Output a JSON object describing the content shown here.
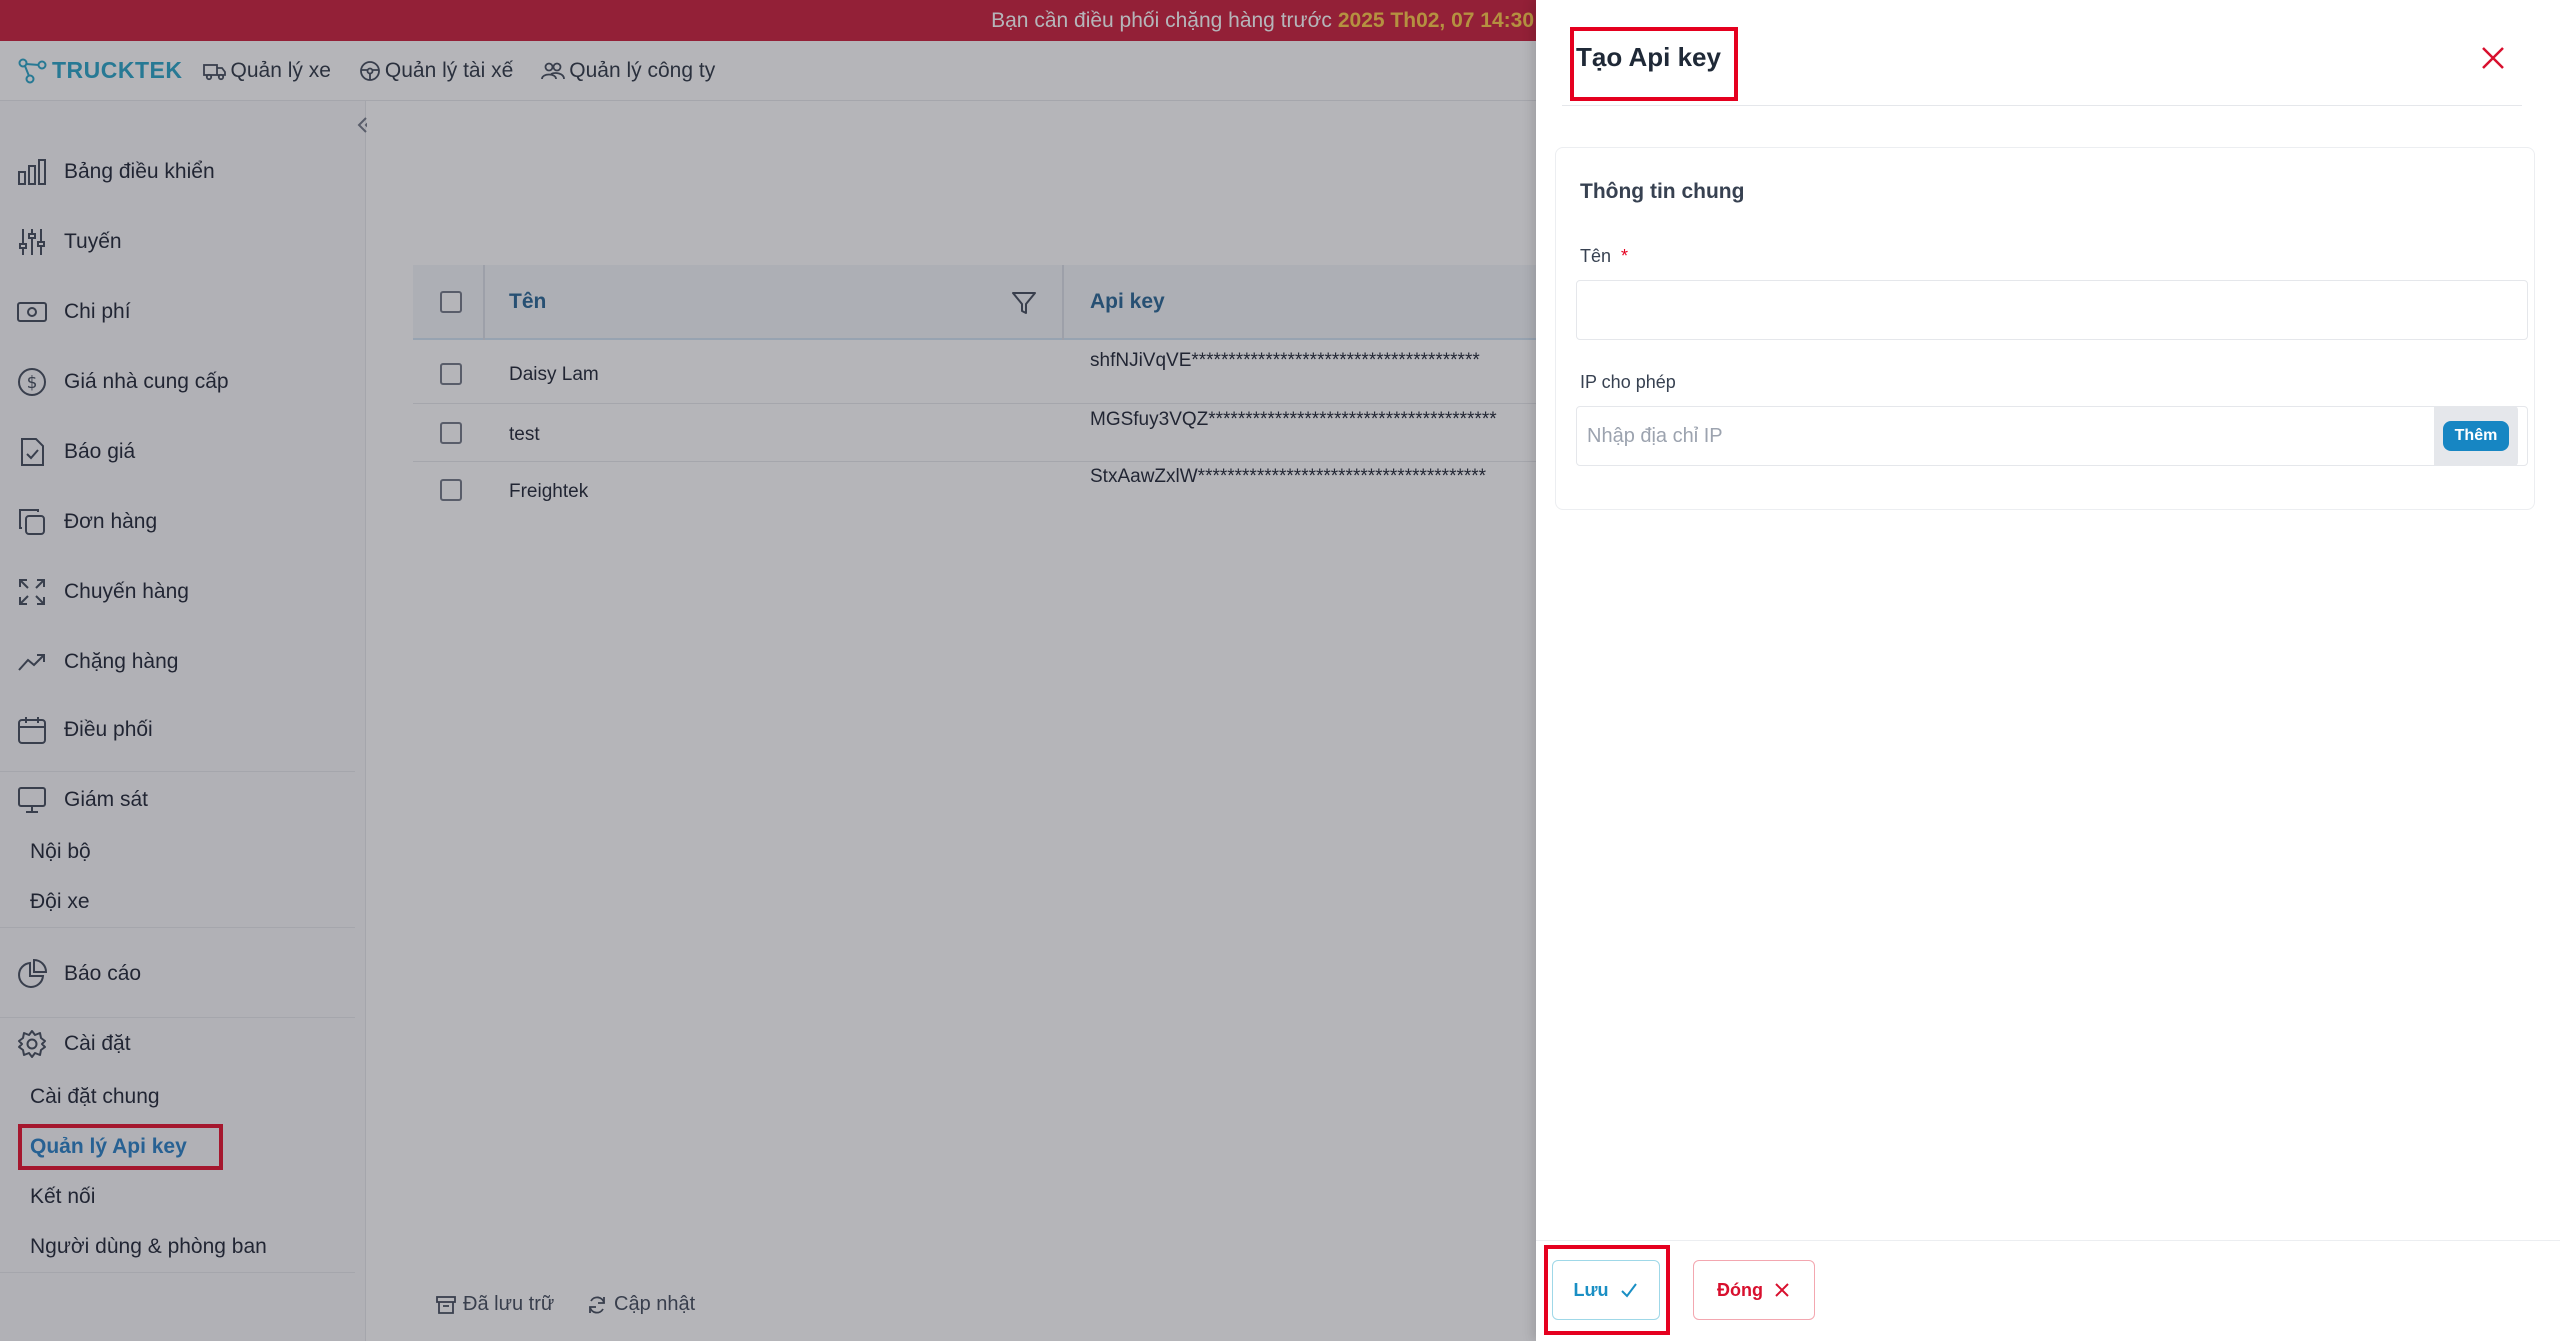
{
  "banner": {
    "text": "Bạn cần điều phối chặng hàng trước",
    "highlight": "2025 Th02, 07 14:30"
  },
  "topnav": {
    "logo": "TRUCKTEK",
    "items": [
      {
        "label": "Quản lý xe",
        "icon": "truck-icon"
      },
      {
        "label": "Quản lý tài xế",
        "icon": "steering-wheel-icon"
      },
      {
        "label": "Quản lý công ty",
        "icon": "users-icon"
      }
    ]
  },
  "sidebar": {
    "items": [
      {
        "label": "Bảng điều khiển",
        "icon": "bar-chart-icon"
      },
      {
        "label": "Tuyến",
        "icon": "sliders-icon"
      },
      {
        "label": "Chi phí",
        "icon": "money-icon"
      },
      {
        "label": "Giá nhà cung cấp",
        "icon": "dollar-circle-icon"
      },
      {
        "label": "Báo giá",
        "icon": "document-check-icon"
      },
      {
        "label": "Đơn hàng",
        "icon": "copy-icon"
      },
      {
        "label": "Chuyến hàng",
        "icon": "expand-icon"
      },
      {
        "label": "Chặng hàng",
        "icon": "trend-up-icon"
      },
      {
        "label": "Điều phối",
        "icon": "calendar-icon"
      },
      {
        "label": "Giám sát",
        "icon": "monitor-icon"
      },
      {
        "label": "Báo cáo",
        "icon": "pie-chart-icon"
      },
      {
        "label": "Cài đặt",
        "icon": "gear-icon"
      }
    ],
    "monitor_sub": [
      "Nội bộ",
      "Đội xe"
    ],
    "settings_sub": [
      "Cài đặt chung",
      "Quản lý Api key",
      "Kết nối",
      "Người dùng & phòng ban"
    ]
  },
  "table": {
    "columns": [
      "Tên",
      "Api key"
    ],
    "rows": [
      {
        "name": "Daisy Lam",
        "key": "shfNJiVqVE***************************************"
      },
      {
        "name": "test",
        "key": "MGSfuy3VQZ***************************************"
      },
      {
        "name": "Freightek",
        "key": "StxAawZxlW***************************************"
      }
    ]
  },
  "footer": {
    "archived": "Đã lưu trữ",
    "refresh": "Cập nhật"
  },
  "drawer": {
    "title": "Tạo Api key",
    "section_title": "Thông tin chung",
    "name_label": "Tên",
    "name_required": "*",
    "ip_label": "IP cho phép",
    "ip_placeholder": "Nhập địa chỉ IP",
    "add_label": "Thêm",
    "save_label": "Lưu",
    "close_label": "Đóng"
  },
  "colors": {
    "banner": "#c8102e",
    "brand": "#1a9fc4",
    "accent": "#1786c3",
    "highlight_box": "#e5001f"
  }
}
